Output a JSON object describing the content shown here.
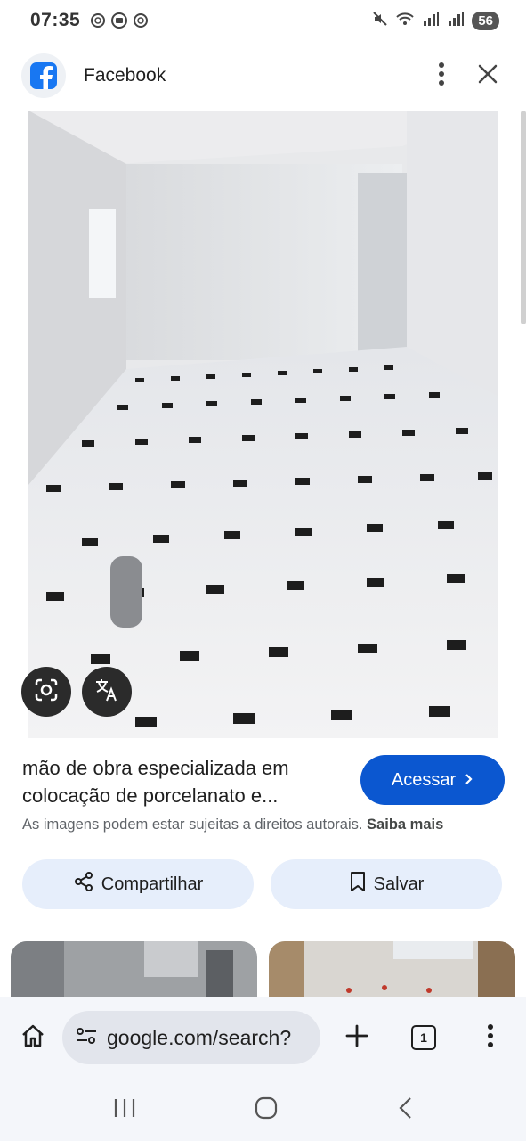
{
  "status_bar": {
    "time": "07:35",
    "battery": "56"
  },
  "header": {
    "site_name": "Facebook"
  },
  "result": {
    "title": "mão de obra especializada em colocação de porcelanato e...",
    "access_label": "Acessar",
    "copyright_text": "As imagens podem estar sujeitas a direitos autorais.",
    "learn_more": "Saiba mais"
  },
  "actions": {
    "share_label": "Compartilhar",
    "save_label": "Salvar"
  },
  "toolbar": {
    "url": "google.com/search?",
    "tab_count": "1"
  },
  "colors": {
    "accent": "#0b57d0",
    "pill_bg": "#e6eefb",
    "facebook_blue": "#1877f2"
  }
}
